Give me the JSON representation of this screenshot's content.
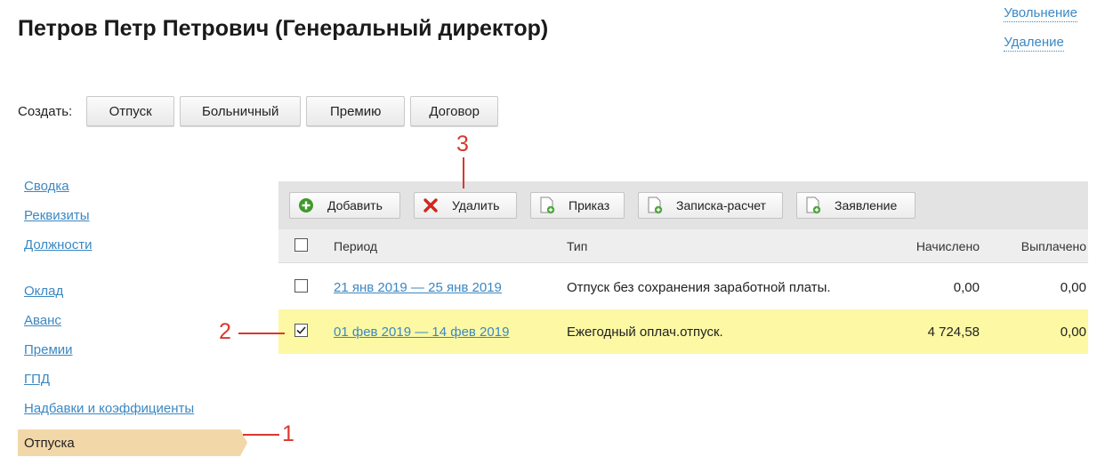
{
  "header": {
    "title": "Петров Петр Петрович (Генеральный директор)"
  },
  "top_links": {
    "dismissal": "Увольнение",
    "delete": "Удаление"
  },
  "create": {
    "label": "Создать:",
    "buttons": [
      "Отпуск",
      "Больничный",
      "Премию",
      "Договор"
    ]
  },
  "sidebar": {
    "group1": [
      "Сводка",
      "Реквизиты",
      "Должности"
    ],
    "group2": [
      "Оклад",
      "Аванс",
      "Премии",
      "ГПД",
      "Надбавки и коэффициенты"
    ],
    "active": "Отпуска"
  },
  "toolbar": {
    "add": "Добавить",
    "delete": "Удалить",
    "order": "Приказ",
    "note": "Записка-расчет",
    "statement": "Заявление"
  },
  "table": {
    "headers": {
      "period": "Период",
      "type": "Тип",
      "accrued": "Начислено",
      "paid": "Выплачено"
    },
    "rows": [
      {
        "period": "21 янв 2019 — 25 янв 2019",
        "type": "Отпуск без сохранения заработной платы.",
        "accrued": "0,00",
        "paid": "0,00",
        "checked": false
      },
      {
        "period": "01 фев 2019 — 14 фев 2019",
        "type": "Ежегодный оплач.отпуск.",
        "accrued": "4 724,58",
        "paid": "0,00",
        "checked": true
      }
    ]
  },
  "annotations": {
    "a1": "1",
    "a2": "2",
    "a3": "3"
  },
  "colors": {
    "link": "#3b88c3",
    "selected_row": "#fcf8a4",
    "active_tab": "#f2d7a9",
    "annotation": "#d8382d"
  }
}
